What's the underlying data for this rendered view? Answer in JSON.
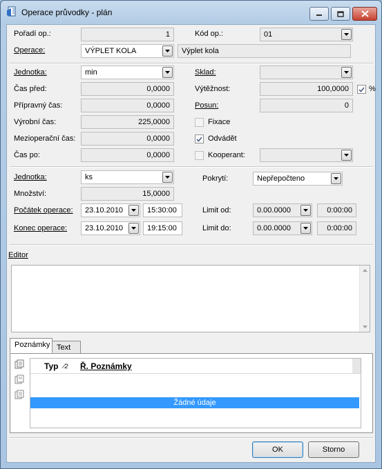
{
  "window": {
    "title": "Operace průvodky - plán",
    "icon": "app-document-icon"
  },
  "fields": {
    "poradi_label": "Pořadí op.:",
    "poradi_value": "1",
    "kod_label": "Kód op.:",
    "kod_value": "01",
    "operace_label": "Operace:",
    "operace_value": "VÝPLET KOLA",
    "operace_desc": "Výplet kola",
    "jednotka1_label": "Jednotka:",
    "jednotka1_value": "min",
    "sklad_label": "Sklad:",
    "sklad_value": "",
    "cas_pred_label": "Čas před:",
    "cas_pred_value": "0,0000",
    "vyteznost_label": "Výtěžnost:",
    "vyteznost_value": "100,0000",
    "pct_label": "%",
    "pripravny_label": "Přípravný čas:",
    "pripravny_value": "0,0000",
    "posun_label": "Posun:",
    "posun_value": "0",
    "vyrobni_label": "Výrobní čas:",
    "vyrobni_value": "225,0000",
    "fixace_label": "Fixace",
    "mezioper_label": "Mezioperační čas:",
    "mezioper_value": "0,0000",
    "odvadet_label": "Odvádět",
    "cas_po_label": "Čas po:",
    "cas_po_value": "0,0000",
    "kooperant_label": "Kooperant:",
    "kooperant_value": "",
    "jednotka2_label": "Jednotka:",
    "jednotka2_value": "ks",
    "pokryti_label": "Pokrytí:",
    "pokryti_value": "Nepřepočteno",
    "mnozstvi_label": "Množství:",
    "mnozstvi_value": "15,0000",
    "pocatek_label": "Počátek operace:",
    "pocatek_date": "23.10.2010",
    "pocatek_time": "15:30:00",
    "limit_od_label": "Limit od:",
    "limit_od_date": "0.00.0000",
    "limit_od_time": "0:00:00",
    "konec_label": "Konec operace:",
    "konec_date": "23.10.2010",
    "konec_time": "19:15:00",
    "limit_do_label": "Limit do:",
    "limit_do_date": "0.00.0000",
    "limit_do_time": "0:00:00"
  },
  "checkboxes": {
    "fixace": false,
    "odvadet": true,
    "kooperant": false,
    "pct": true
  },
  "editor": {
    "label": "Editor",
    "value": ""
  },
  "tabs": [
    {
      "label": "Poznámky"
    },
    {
      "label": "Text"
    }
  ],
  "grid": {
    "col_typ": "Typ",
    "col_sort": "2",
    "col_poznamky": "Ř. Poznámky",
    "empty_text": "Žádné údaje"
  },
  "buttons": {
    "ok": "OK",
    "cancel": "Storno"
  }
}
